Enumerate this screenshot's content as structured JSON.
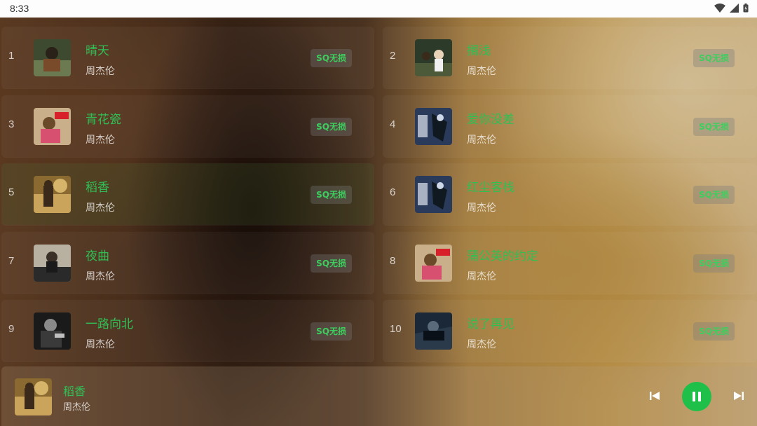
{
  "status": {
    "time": "8:33"
  },
  "songs": [
    {
      "index": "1",
      "title": "晴天",
      "artist": "周杰伦",
      "quality": "SQ无损",
      "cover": "cover-a"
    },
    {
      "index": "2",
      "title": "搁浅",
      "artist": "周杰伦",
      "quality": "SQ无损",
      "cover": "cover-b"
    },
    {
      "index": "3",
      "title": "青花瓷",
      "artist": "周杰伦",
      "quality": "SQ无损",
      "cover": "cover-c"
    },
    {
      "index": "4",
      "title": "爱你没差",
      "artist": "周杰伦",
      "quality": "SQ无损",
      "cover": "cover-d"
    },
    {
      "index": "5",
      "title": "稻香",
      "artist": "周杰伦",
      "quality": "SQ无损",
      "cover": "cover-e",
      "active": true
    },
    {
      "index": "6",
      "title": "红尘客栈",
      "artist": "周杰伦",
      "quality": "SQ无损",
      "cover": "cover-d"
    },
    {
      "index": "7",
      "title": "夜曲",
      "artist": "周杰伦",
      "quality": "SQ无损",
      "cover": "cover-f"
    },
    {
      "index": "8",
      "title": "蒲公英的约定",
      "artist": "周杰伦",
      "quality": "SQ无损",
      "cover": "cover-c"
    },
    {
      "index": "9",
      "title": "一路向北",
      "artist": "周杰伦",
      "quality": "SQ无损",
      "cover": "cover-g"
    },
    {
      "index": "10",
      "title": "说了再见",
      "artist": "周杰伦",
      "quality": "SQ无损",
      "cover": "cover-h"
    }
  ],
  "player": {
    "title": "稻香",
    "artist": "周杰伦",
    "state": "playing"
  },
  "colors": {
    "accent": "#2fbf55",
    "play_button": "#1fc04a"
  }
}
